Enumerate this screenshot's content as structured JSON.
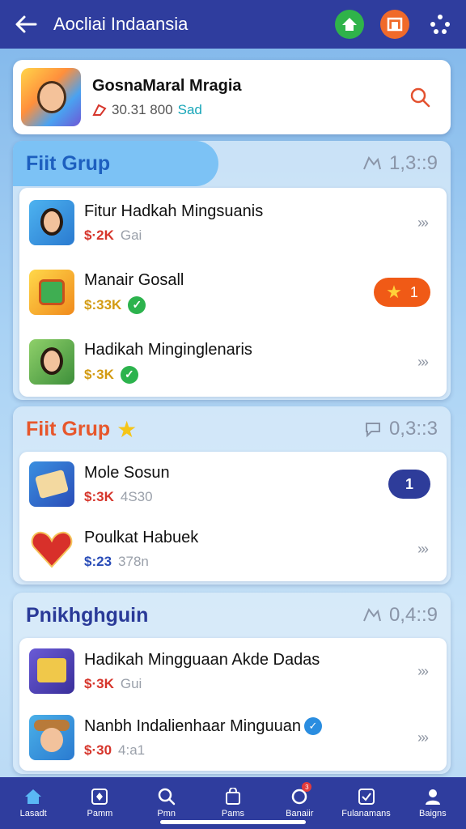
{
  "header": {
    "title": "Aocliai Indaansia",
    "back_icon": "arrow-left-icon",
    "actions": [
      {
        "icon": "home-up-icon",
        "color": "#2fb34a"
      },
      {
        "icon": "image-frame-icon",
        "color": "#f06a2a"
      },
      {
        "icon": "network-icon",
        "color": "#ffffff"
      }
    ]
  },
  "profile": {
    "name": "GosnaMaral Mragia",
    "stats": "30.31 800",
    "tag": "Sad"
  },
  "sections": [
    {
      "title": "Fiit Grup",
      "count": "1,3::9",
      "items": [
        {
          "label": "Fitur Hadkah Mingsuanis",
          "price": "$·2K",
          "price_color": "#d6352b",
          "extra": "Gai",
          "trail": "›››"
        },
        {
          "label": "Manair Gosall",
          "price": "$:33K",
          "price_color": "#d39b12",
          "extra": "",
          "trail_badge": "1"
        },
        {
          "label": "Hadikah Minginglenaris",
          "price": "$·3K",
          "price_color": "#d39b12",
          "extra": "",
          "trail": "›››"
        }
      ]
    },
    {
      "title": "Fiit Grup",
      "count": "0,3::3",
      "items": [
        {
          "label": "Mole Sosun",
          "price": "$:3K",
          "price_color": "#d6352b",
          "extra": "4S30",
          "trail_badge": "1"
        },
        {
          "label": "Poulkat Habuek",
          "price": "$:23",
          "price_color": "#2a4db8",
          "extra": "378n",
          "trail": "›››"
        }
      ]
    },
    {
      "title": "Pnikhghguin",
      "count": "0,4::9",
      "items": [
        {
          "label": "Hadikah Mingguaan Akde Dadas",
          "price": "$·3K",
          "price_color": "#d6352b",
          "extra": "Gui",
          "trail": "›››"
        },
        {
          "label": "Nanbh Indalienhaar Minguuan",
          "price": "$·30",
          "price_color": "#d6352b",
          "extra": "4:a1",
          "trail": "›››"
        }
      ]
    }
  ],
  "bottom_nav": [
    {
      "label": "Lasadt",
      "icon": "home-icon"
    },
    {
      "label": "Pamm",
      "icon": "card-icon"
    },
    {
      "label": "Pmn",
      "icon": "search-icon"
    },
    {
      "label": "Pams",
      "icon": "bag-icon"
    },
    {
      "label": "Banaiir",
      "icon": "chat-icon",
      "badge": "3"
    },
    {
      "label": "Fulanamans",
      "icon": "check-card-icon"
    },
    {
      "label": "Baigns",
      "icon": "user-icon"
    }
  ]
}
